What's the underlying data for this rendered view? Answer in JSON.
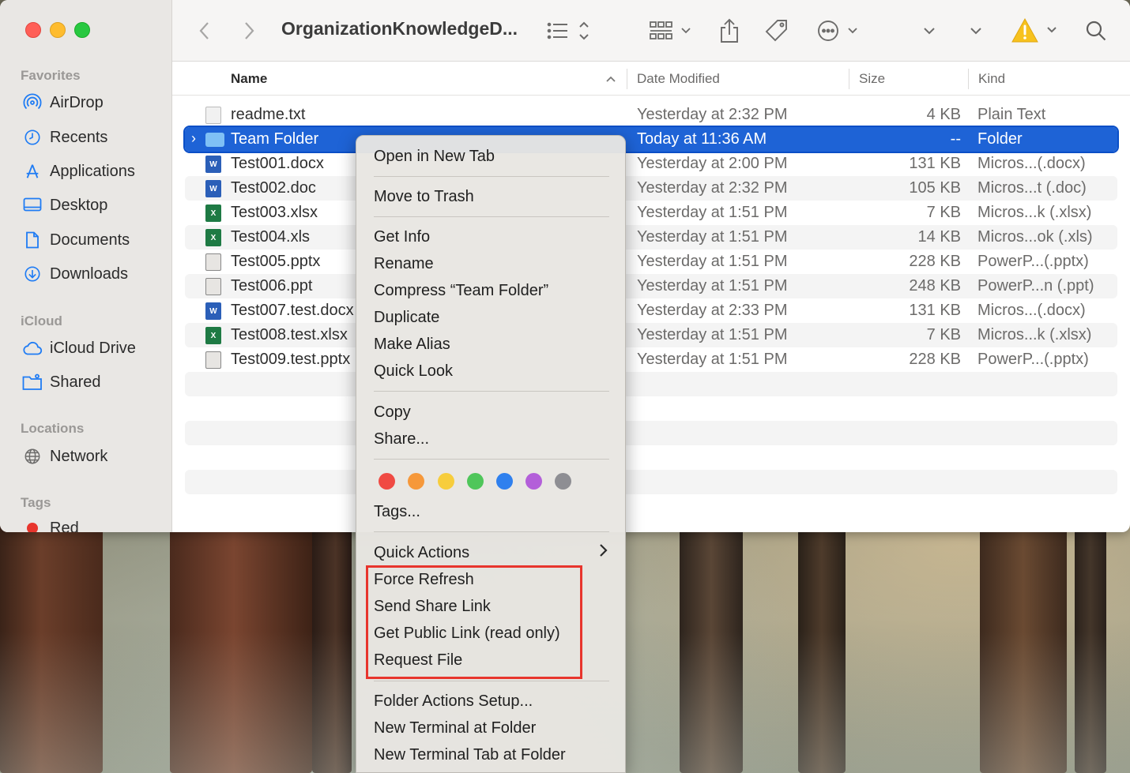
{
  "window": {
    "title": "OrganizationKnowledgeD..."
  },
  "sidebar": {
    "favorites_label": "Favorites",
    "favorites": [
      {
        "label": "AirDrop",
        "icon": "airdrop-icon"
      },
      {
        "label": "Recents",
        "icon": "clock-icon"
      },
      {
        "label": "Applications",
        "icon": "applications-icon"
      },
      {
        "label": "Desktop",
        "icon": "desktop-icon"
      },
      {
        "label": "Documents",
        "icon": "document-icon"
      },
      {
        "label": "Downloads",
        "icon": "download-icon"
      }
    ],
    "icloud_label": "iCloud",
    "icloud": [
      {
        "label": "iCloud Drive",
        "icon": "cloud-icon"
      },
      {
        "label": "Shared",
        "icon": "shared-folder-icon"
      }
    ],
    "locations_label": "Locations",
    "locations": [
      {
        "label": "Network",
        "icon": "globe-icon"
      }
    ],
    "tags_label": "Tags",
    "tags": [
      {
        "label": "Red",
        "color": "#e8352d"
      }
    ]
  },
  "columns": {
    "name": "Name",
    "date": "Date Modified",
    "size": "Size",
    "kind": "Kind"
  },
  "files": [
    {
      "name": "readme.txt",
      "date": "Yesterday at 2:32 PM",
      "size": "4 KB",
      "kind": "Plain Text",
      "icon": "text-file-icon"
    },
    {
      "name": "Team Folder",
      "date": "Today at 11:36 AM",
      "size": "--",
      "kind": "Folder",
      "icon": "folder-icon"
    },
    {
      "name": "Test001.docx",
      "date": "Yesterday at 2:00 PM",
      "size": "131 KB",
      "kind": "Micros...(.docx)",
      "icon": "word-file-icon"
    },
    {
      "name": "Test002.doc",
      "date": "Yesterday at 2:32 PM",
      "size": "105 KB",
      "kind": "Micros...t (.doc)",
      "icon": "word-file-icon"
    },
    {
      "name": "Test003.xlsx",
      "date": "Yesterday at 1:51 PM",
      "size": "7 KB",
      "kind": "Micros...k (.xlsx)",
      "icon": "excel-file-icon"
    },
    {
      "name": "Test004.xls",
      "date": "Yesterday at 1:51 PM",
      "size": "14 KB",
      "kind": "Micros...ok (.xls)",
      "icon": "excel-file-icon"
    },
    {
      "name": "Test005.pptx",
      "date": "Yesterday at 1:51 PM",
      "size": "228 KB",
      "kind": "PowerP...(.pptx)",
      "icon": "powerpoint-file-icon"
    },
    {
      "name": "Test006.ppt",
      "date": "Yesterday at 1:51 PM",
      "size": "248 KB",
      "kind": "PowerP...n (.ppt)",
      "icon": "powerpoint-file-icon"
    },
    {
      "name": "Test007.test.docx",
      "date": "Yesterday at 2:33 PM",
      "size": "131 KB",
      "kind": "Micros...(.docx)",
      "icon": "word-file-icon"
    },
    {
      "name": "Test008.test.xlsx",
      "date": "Yesterday at 1:51 PM",
      "size": "7 KB",
      "kind": "Micros...k (.xlsx)",
      "icon": "excel-file-icon"
    },
    {
      "name": "Test009.test.pptx",
      "date": "Yesterday at 1:51 PM",
      "size": "228 KB",
      "kind": "PowerP...(.pptx)",
      "icon": "powerpoint-file-icon"
    }
  ],
  "context_menu": {
    "open_new_tab": "Open in New Tab",
    "move_to_trash": "Move to Trash",
    "get_info": "Get Info",
    "rename": "Rename",
    "compress": "Compress “Team Folder”",
    "duplicate": "Duplicate",
    "make_alias": "Make Alias",
    "quick_look": "Quick Look",
    "copy": "Copy",
    "share": "Share...",
    "tag_colors": [
      "#f04a43",
      "#f6983a",
      "#f7cd3c",
      "#4fc65a",
      "#2f80ee",
      "#b35fd9",
      "#8e8e93"
    ],
    "tags": "Tags...",
    "quick_actions": "Quick Actions",
    "force_refresh": "Force Refresh",
    "send_share_link": "Send Share Link",
    "get_public_link": "Get Public Link (read only)",
    "request_file": "Request File",
    "folder_actions_setup": "Folder Actions Setup...",
    "new_terminal": "New Terminal at Folder",
    "new_terminal_tab": "New Terminal Tab at Folder"
  },
  "colors": {
    "selection": "#1e63d6",
    "highlight_box": "#e8352d",
    "warning": "#f7c21e"
  }
}
